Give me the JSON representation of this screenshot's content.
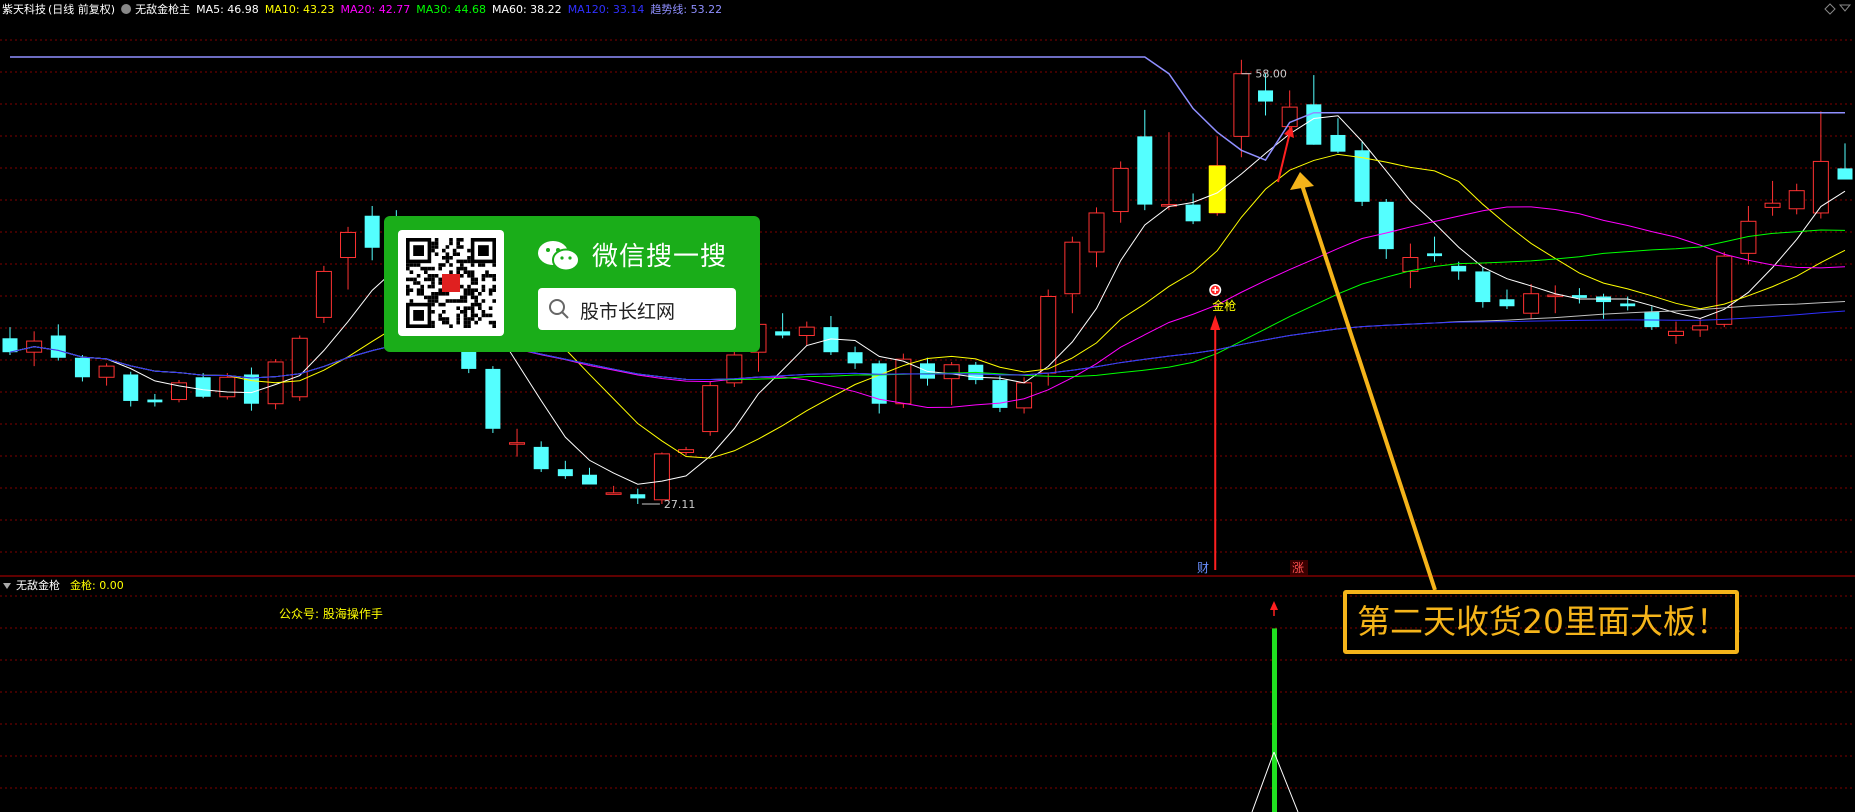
{
  "header": {
    "stock_name": "紫天科技",
    "mode": "(日线 前复权)",
    "indicator": "无敌金枪主",
    "ma": [
      {
        "label": "MA5: 46.98",
        "color": "#ffffff"
      },
      {
        "label": "MA10: 43.23",
        "color": "#ffff00"
      },
      {
        "label": "MA20: 42.77",
        "color": "#ff00ff"
      },
      {
        "label": "MA30: 44.68",
        "color": "#00ff00"
      },
      {
        "label": "MA60: 38.22",
        "color": "#ffffff"
      },
      {
        "label": "MA120: 33.14",
        "color": "#3030ff"
      },
      {
        "label": "趋势线: 53.22",
        "color": "#8f8fff"
      }
    ]
  },
  "price_labels": {
    "high": "58.00",
    "low": "27.11"
  },
  "markers": {
    "cai": "财",
    "zhang": "涨",
    "jinqiang": "金枪"
  },
  "sub_panel": {
    "title": "无敌金枪",
    "value_label": "金枪: 0.00",
    "public_account": "公众号: 股海操作手"
  },
  "wechat_ad": {
    "title": "微信搜一搜",
    "search_text": "股市长红网"
  },
  "callout": "第二天收货20里面大板！！",
  "colors": {
    "up": "#ff3232",
    "down": "#54ffff",
    "grid": "#800000",
    "trend": "#8f8fff"
  },
  "chart_data": {
    "type": "candlestick",
    "ylim": [
      22,
      62
    ],
    "candles": [
      [
        39.0,
        39.8,
        37.8,
        38.0
      ],
      [
        38.0,
        39.5,
        37.0,
        38.8
      ],
      [
        39.2,
        40.0,
        37.4,
        37.6
      ],
      [
        37.6,
        37.8,
        35.9,
        36.2
      ],
      [
        36.2,
        37.2,
        35.6,
        37.0
      ],
      [
        36.4,
        36.6,
        34.1,
        34.5
      ],
      [
        34.6,
        35.0,
        34.1,
        34.4
      ],
      [
        34.6,
        36.0,
        34.4,
        35.8
      ],
      [
        36.2,
        36.5,
        34.7,
        34.8
      ],
      [
        34.8,
        36.5,
        34.6,
        36.2
      ],
      [
        36.4,
        36.9,
        33.8,
        34.3
      ],
      [
        34.3,
        37.5,
        33.9,
        37.3
      ],
      [
        34.8,
        39.2,
        34.5,
        39.0
      ],
      [
        40.5,
        44.2,
        40.1,
        43.8
      ],
      [
        44.8,
        47.0,
        42.5,
        46.6
      ],
      [
        47.8,
        48.5,
        44.6,
        45.5
      ],
      [
        46.3,
        48.2,
        45.0,
        45.2
      ],
      [
        44.5,
        45.8,
        42.8,
        43.2
      ],
      [
        42.8,
        43.3,
        41.8,
        42.2
      ],
      [
        42.3,
        43.5,
        36.5,
        36.8
      ],
      [
        36.8,
        37.0,
        32.2,
        32.5
      ],
      [
        31.5,
        32.5,
        30.5,
        31.5
      ],
      [
        31.2,
        31.6,
        29.4,
        29.6
      ],
      [
        29.6,
        30.2,
        28.9,
        29.1
      ],
      [
        29.2,
        29.7,
        28.7,
        28.5
      ],
      [
        27.9,
        28.4,
        27.8,
        27.9
      ],
      [
        27.8,
        28.2,
        27.1,
        27.5
      ],
      [
        27.4,
        30.8,
        27.1,
        30.7
      ],
      [
        30.8,
        31.2,
        30.6,
        31.0
      ],
      [
        32.3,
        35.9,
        32.0,
        35.6
      ],
      [
        35.8,
        38.2,
        35.5,
        37.8
      ],
      [
        38.0,
        40.2,
        36.6,
        40.0
      ],
      [
        39.5,
        40.8,
        39.0,
        39.2
      ],
      [
        39.2,
        40.2,
        38.5,
        39.8
      ],
      [
        39.8,
        40.6,
        37.8,
        38.0
      ],
      [
        38.0,
        38.4,
        36.8,
        37.2
      ],
      [
        37.2,
        37.4,
        33.6,
        34.3
      ],
      [
        34.3,
        37.9,
        34.0,
        37.5
      ],
      [
        37.2,
        37.6,
        35.6,
        36.1
      ],
      [
        36.1,
        37.3,
        34.2,
        37.1
      ],
      [
        37.1,
        37.3,
        35.7,
        36.0
      ],
      [
        36.0,
        36.3,
        33.7,
        34.0
      ],
      [
        34.0,
        36.2,
        33.6,
        35.8
      ],
      [
        36.5,
        42.5,
        35.6,
        42.0
      ],
      [
        42.2,
        46.3,
        40.8,
        45.9
      ],
      [
        45.2,
        48.4,
        44.1,
        48.0
      ],
      [
        48.1,
        51.7,
        47.3,
        51.2
      ],
      [
        53.5,
        55.4,
        48.2,
        48.6
      ],
      [
        48.6,
        53.8,
        48.2,
        48.6
      ],
      [
        48.6,
        49.4,
        47.2,
        47.4
      ],
      [
        48.0,
        53.5,
        47.8,
        51.4
      ],
      [
        53.5,
        59.0,
        52.0,
        58.0
      ],
      [
        56.8,
        58.0,
        55.0,
        56.0
      ],
      [
        54.2,
        56.8,
        53.8,
        55.6
      ],
      [
        55.8,
        57.9,
        52.9,
        52.9
      ],
      [
        53.6,
        54.8,
        52.3,
        52.4
      ],
      [
        52.5,
        53.1,
        48.5,
        48.8
      ],
      [
        48.8,
        49.0,
        44.7,
        45.4
      ],
      [
        43.8,
        45.8,
        42.6,
        44.8
      ],
      [
        45.1,
        46.3,
        44.5,
        44.9
      ],
      [
        44.2,
        44.5,
        43.2,
        43.8
      ],
      [
        43.8,
        44.1,
        41.2,
        41.6
      ],
      [
        41.8,
        42.5,
        41.1,
        41.3
      ],
      [
        40.8,
        42.9,
        40.4,
        42.2
      ],
      [
        42.1,
        42.8,
        40.8,
        42.1
      ],
      [
        42.1,
        42.6,
        41.5,
        41.9
      ],
      [
        42.0,
        42.2,
        40.4,
        41.6
      ],
      [
        41.5,
        42.0,
        41.0,
        41.3
      ],
      [
        40.9,
        41.3,
        39.6,
        39.8
      ],
      [
        39.2,
        40.2,
        38.6,
        39.5
      ],
      [
        39.6,
        40.4,
        39.1,
        39.9
      ],
      [
        40.0,
        45.2,
        39.8,
        44.9
      ],
      [
        45.1,
        48.5,
        44.3,
        47.4
      ],
      [
        48.4,
        50.3,
        47.8,
        48.7
      ],
      [
        48.3,
        50.1,
        47.9,
        49.6
      ],
      [
        48.0,
        55.3,
        47.6,
        51.7
      ],
      [
        51.2,
        53.0,
        50.6,
        50.4
      ]
    ],
    "signal_bar_value": 9.0
  }
}
